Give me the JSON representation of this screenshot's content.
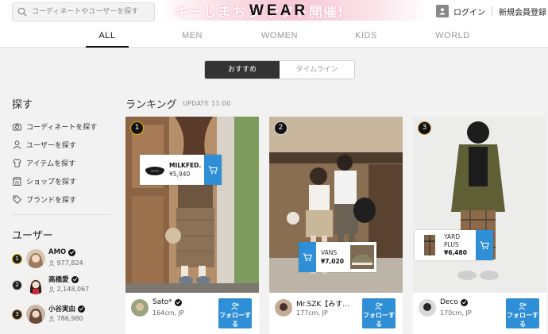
{
  "header": {
    "search_placeholder": "コーディネートやユーザーを探す",
    "logo": "WEAR",
    "banner_text": "キーしまおう ラフト開催!",
    "login": "ログイン",
    "register": "新規会員登録"
  },
  "tabs": [
    "ALL",
    "MEN",
    "WOMEN",
    "KIDS",
    "WORLD"
  ],
  "active_tab": "ALL",
  "toggle": {
    "recommended": "おすすめ",
    "timeline": "タイムライン",
    "selected": "おすすめ"
  },
  "sidebar": {
    "search_title": "探す",
    "menu": [
      {
        "label": "コーディネートを探す",
        "icon": "camera-icon"
      },
      {
        "label": "ユーザーを探す",
        "icon": "person-icon"
      },
      {
        "label": "アイテムを探す",
        "icon": "shirt-icon"
      },
      {
        "label": "ショップを探す",
        "icon": "shop-icon"
      },
      {
        "label": "ブランドを探す",
        "icon": "tag-icon"
      }
    ],
    "users_title": "ユーザー",
    "users": [
      {
        "rank": "1",
        "name": "AMO",
        "followers": "977,824"
      },
      {
        "rank": "2",
        "name": "高橋愛",
        "followers": "2,148,067"
      },
      {
        "rank": "3",
        "name": "小谷実由",
        "followers": "786,980"
      }
    ]
  },
  "ranking": {
    "title": "ランキング",
    "update": "UPDATE 11:00",
    "follow_label": "フォローする",
    "cards": [
      {
        "rank": "1",
        "user": "Sato*",
        "info": "164cm, JP",
        "item": {
          "brand": "MILKFED.",
          "price": "¥5,940"
        }
      },
      {
        "rank": "2",
        "user": "Mr.SZK【みす…",
        "info": "177cm, JP",
        "item": {
          "brand": "VANS",
          "price": "¥7,020"
        }
      },
      {
        "rank": "3",
        "user": "Deco",
        "info": "170cm, JP",
        "item": {
          "brand": "YARD PLUS",
          "price": "¥6,480"
        }
      }
    ]
  },
  "colors": {
    "accent": "#2f8fd6",
    "gold": "#e0b000",
    "silver": "#cfcfcf",
    "bronze": "#c58a3a"
  }
}
